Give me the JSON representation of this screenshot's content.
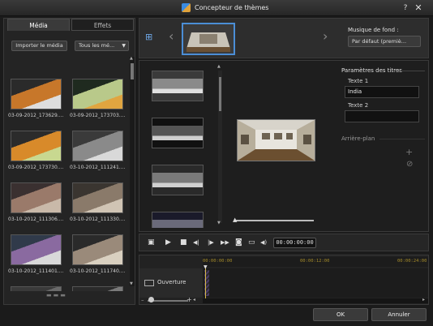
{
  "window": {
    "title": "Concepteur de thèmes",
    "help_glyph": "?",
    "close_glyph": "✕"
  },
  "left_panel": {
    "tabs": [
      {
        "label": "Média"
      },
      {
        "label": "Effets"
      }
    ],
    "import_label": "Importer le média",
    "filter_value": "Tous les mé...",
    "media_items": [
      {
        "label": "03-09-2012_173629....",
        "colors": [
          "#2a2a2a",
          "#c7772a",
          "#dddddd"
        ]
      },
      {
        "label": "03-09-2012_173703....",
        "colors": [
          "#1f2a1f",
          "#b9c98a",
          "#e0a540"
        ]
      },
      {
        "label": "03-09-2012_173730....",
        "colors": [
          "#2b2b2b",
          "#d88a2a",
          "#c8d890"
        ]
      },
      {
        "label": "03-10-2012_111241....",
        "colors": [
          "#3a3a3a",
          "#8a8a8a",
          "#d9d9d9"
        ]
      },
      {
        "label": "03-10-2012_111306....",
        "colors": [
          "#3a3030",
          "#9a7a6a",
          "#c9b9a9"
        ]
      },
      {
        "label": "03-10-2012_111330....",
        "colors": [
          "#3a3530",
          "#8a7a6a",
          "#d0c4b4"
        ]
      },
      {
        "label": "03-10-2012_111401....",
        "colors": [
          "#303a4a",
          "#8a6aa0",
          "#d9d9d9"
        ]
      },
      {
        "label": "03-10-2012_111740....",
        "colors": [
          "#2a2a2a",
          "#9a8a7a",
          "#d9d0c0"
        ]
      },
      {
        "label": "",
        "colors": [
          "#3a3a3a",
          "#6a6a6a",
          "#cfcfcf"
        ]
      },
      {
        "label": "",
        "colors": [
          "#2a2a2a",
          "#7a7a7a",
          "#bcbcbc"
        ]
      }
    ],
    "bottom_icons": "▬▬▬"
  },
  "top_strip": {
    "add_glyph": "⊞",
    "prev_glyph": "‹",
    "next_glyph": "›",
    "music_label": "Musique de fond :",
    "music_value": "Par défaut (premiè..."
  },
  "scene_list": {
    "thumbs": [
      {
        "colors": [
          "#3a3a3a",
          "#8a8a8a",
          "#e0e0e0"
        ]
      },
      {
        "colors": [
          "#111111",
          "#555555",
          "#cfcfcf"
        ]
      },
      {
        "colors": [
          "#2a2a2a",
          "#7a7a7a",
          "#d0d0d0"
        ]
      },
      {
        "colors": [
          "#1a1a2a",
          "#6a6a7a",
          "#cfcfcf"
        ]
      }
    ]
  },
  "title_params": {
    "heading": "Paramètres des titres",
    "text1_label": "Texte 1",
    "text1_value": "India",
    "text2_label": "Texte 2",
    "text2_value": "",
    "background_label": "Arrière-plan",
    "add_glyph": "+",
    "remove_glyph": "⊘"
  },
  "playback": {
    "timecode": "00:00:00:00",
    "glyphs": {
      "storyboard": "▣",
      "play": "▶",
      "stop": "■",
      "prev_frame": "◀|",
      "next_frame": "|▶",
      "fast_forward": "▶▶",
      "snapshot": "◙",
      "display": "▭",
      "volume": "◀)"
    }
  },
  "timeline": {
    "ticks": [
      "00:00:00:00",
      "00:00:12:00",
      "00:00:24:00"
    ],
    "track_label": "Ouverture",
    "zoom_minus": "–",
    "zoom_plus": "+",
    "scroll_left": "◂",
    "scroll_right": "▸"
  },
  "footer": {
    "ok_label": "OK",
    "cancel_label": "Annuler"
  }
}
